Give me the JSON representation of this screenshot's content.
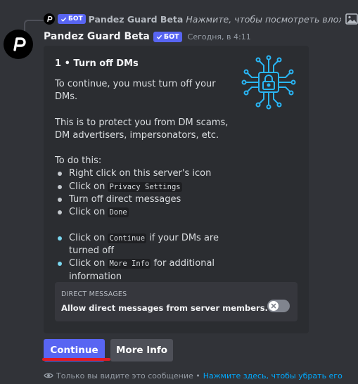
{
  "reply": {
    "author": "Pandez Guard Beta",
    "bot_tag": "БОТ",
    "text": "Нажмите, чтобы посмотреть вложение",
    "attachment_icon": "image-icon"
  },
  "message": {
    "author": "Pandez Guard Beta",
    "bot_tag": "БОТ",
    "timestamp": "Сегодня, в 4:11"
  },
  "embed": {
    "title": "1 • Turn off DMs",
    "intro": "To continue, you must turn off your DMs.",
    "reason": "This is to protect you from DM scams, DM advertisers, impersonators, etc.",
    "todo_heading": "To do this:",
    "steps": [
      {
        "text": "Right click on this server's icon"
      },
      {
        "pre": "Click on ",
        "code": "Privacy Settings"
      },
      {
        "text": "Turn off direct messages"
      },
      {
        "pre": "Click on ",
        "code": "Done"
      }
    ],
    "extra_steps": [
      {
        "pre": "Click on ",
        "code": "Continue",
        "post": " if your DMs are turned off"
      },
      {
        "pre": "Click on ",
        "code": "More Info",
        "post": " for additional information"
      }
    ],
    "thumbnail_icon": "circuit-lock-icon",
    "field": {
      "name": "DIRECT MESSAGES",
      "value": "Allow direct messages from server members.",
      "toggle_state": "off"
    }
  },
  "buttons": {
    "continue_label": "Continue",
    "more_info_label": "More Info"
  },
  "ephemeral": {
    "text": "Только вы видите это сообщение •",
    "dismiss_link": "Нажмите здесь, чтобы убрать его"
  },
  "colors": {
    "background": "#313338",
    "embed_background": "#2b2d31",
    "accent": "#5865f2",
    "link": "#00a8fc",
    "highlight_underline": "#e01b24",
    "icon_cyan": "#29b6f6"
  }
}
